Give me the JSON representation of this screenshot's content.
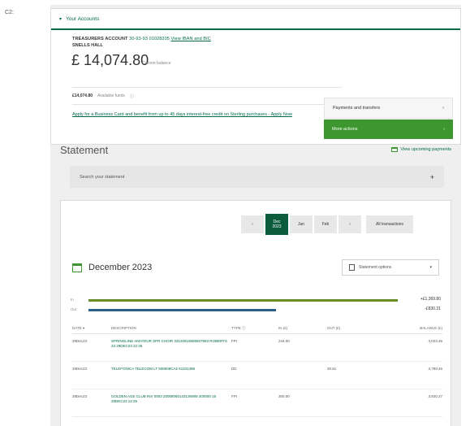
{
  "corner_label": "C2:",
  "accounts": {
    "header_label": "Your Accounts",
    "account_name": "TREASURERS ACCOUNT",
    "sort_code": "30-93-93",
    "account_number": "01028205",
    "view_iban_link": "View IBAN and BIC",
    "holder": "SNELLS HALL",
    "balance": "£ 14,074.80",
    "balance_label": "Current balance",
    "available_amount": "£14,074.80",
    "available_label": "Available funds",
    "promo_text": "Apply for a Business Card and benefit from up to 45 days interest-free credit on Sterling purchases - Apply Now",
    "payments_label": "Payments and transfers",
    "more_actions_label": "More actions"
  },
  "statement": {
    "title": "Statement",
    "upcoming_label": "View upcoming payments",
    "search_placeholder": "Search your statement"
  },
  "month_nav": {
    "prev": "‹",
    "current_month": "Dec",
    "current_year": "2023",
    "next1": "Jan",
    "next2": "Feb",
    "next": "›",
    "all_label": "All transactions"
  },
  "month_section": {
    "title": "December 2023",
    "options_label": "Statement options",
    "in_label": "In",
    "out_label": "Out",
    "in_total": "+£1,369.80",
    "out_total": "-£830.31",
    "in_fraction": 0.94,
    "out_fraction": 0.57
  },
  "colors": {
    "brand_green": "#006a4d",
    "accent_green": "#3d9630",
    "in_bar": "#6b8e23",
    "out_bar": "#2c5e8a"
  },
  "table": {
    "headers": [
      "DATE ▾",
      "DESCRIPTION",
      "TYPE ⓘ",
      "IN (£)",
      "OUT (£)",
      "BALANCE (£)"
    ],
    "rows": [
      {
        "date": "29Dec23",
        "desc": "SPRINGLINE AMATEUR SPR CHOIR 33120919806507893 ROBERTS 33 29DEC23 22:36",
        "type": "FPI",
        "in": "234.00",
        "out": "",
        "balance": "4,023.46"
      },
      {
        "date": "29Dec23",
        "desc": "TELEFONICA TELECOM LT 508508CA2 61101398",
        "type": "DD",
        "in": "",
        "out": "30.81",
        "balance": "3,789.46"
      },
      {
        "date": "28Dec23",
        "desc": "GOLDEN AGE CLUB INV 0003 20008060143136908 300000 15 28DEC23 12:25",
        "type": "FPI",
        "in": "300.00",
        "out": "",
        "balance": "3,820.27"
      }
    ]
  }
}
